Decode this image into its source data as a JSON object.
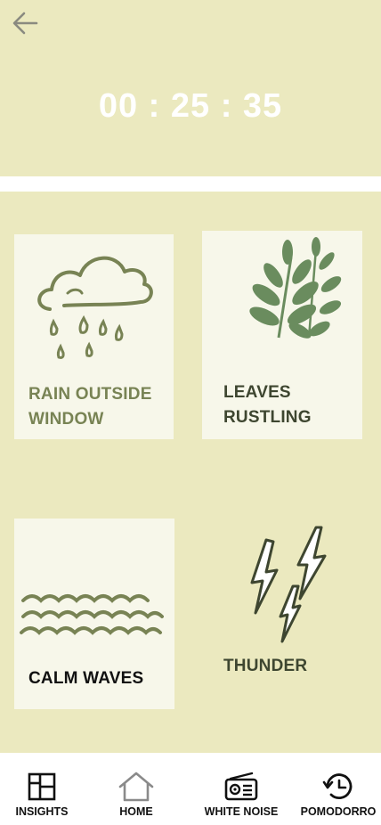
{
  "timer": {
    "display": "00 : 25 : 35"
  },
  "sounds": [
    {
      "label_line1": "RAIN OUTSIDE",
      "label_line2": "WINDOW",
      "icon": "rain-cloud-icon",
      "label_color": "#788354"
    },
    {
      "label_line1": "LEAVES",
      "label_line2": "RUSTLING",
      "icon": "leaves-icon",
      "label_color": "#3e4630"
    },
    {
      "label_line1": "CALM WAVES",
      "icon": "waves-icon",
      "label_color": "#111111"
    },
    {
      "label_line1": "THUNDER",
      "icon": "thunder-icon",
      "label_color": "#3e4630"
    }
  ],
  "nav": {
    "items": [
      {
        "label": "INSIGHTS",
        "icon": "insights-icon"
      },
      {
        "label": "HOME",
        "icon": "home-icon"
      },
      {
        "label": "WHITE NOISE",
        "icon": "radio-icon"
      },
      {
        "label": "POMODORRO",
        "icon": "history-clock-icon"
      }
    ]
  },
  "colors": {
    "background": "#ebe9bf",
    "card": "#f7f7ea",
    "accent_green": "#788354",
    "leaf_green": "#6a8c5e",
    "dark_olive": "#3e4630"
  }
}
